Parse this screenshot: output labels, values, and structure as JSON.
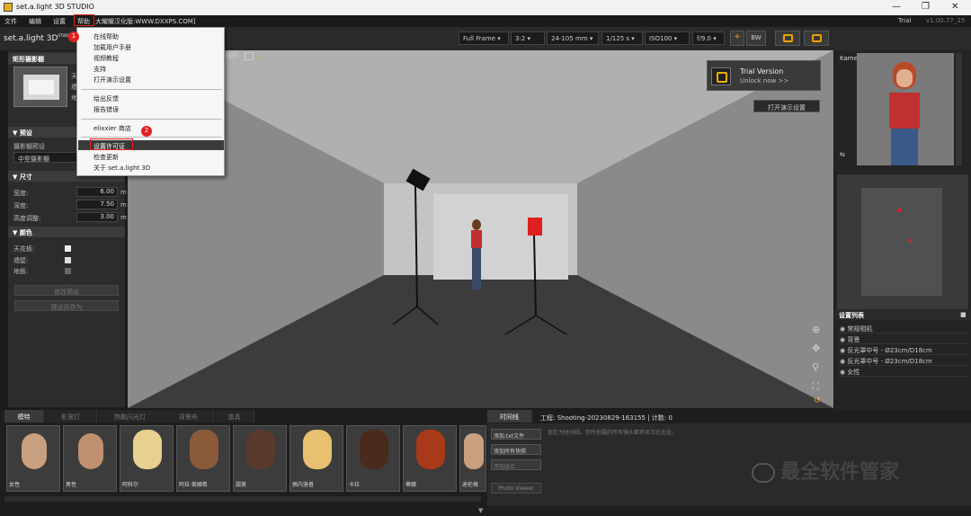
{
  "window": {
    "title": "set.a.light 3D STUDIO",
    "minimize": "—",
    "maximize": "❐",
    "close": "✕"
  },
  "menubar": {
    "items": [
      "文件",
      "编辑",
      "设置",
      "帮助"
    ],
    "tagline": "大耀耀汉化版:WWW.DXXPS.COM]",
    "trial": "Trial",
    "version": "v1.00.77_25"
  },
  "toolbar": {
    "logo": "set.a.light 3D",
    "logo_sup": "STUDIO",
    "frame": "Full Frame",
    "ratio": "3:2",
    "lens": "24-105 mm",
    "shutter": "1/125 s",
    "iso": "ISO100",
    "aperture": "f/9.0",
    "bw": "BW"
  },
  "help_menu": {
    "items": [
      "在线帮助",
      "加载用户手册",
      "视频教程",
      "支持",
      "打开演示设置",
      "给出反馈",
      "报告错误",
      "elixxier 商店",
      "设置许可证",
      "检查更新",
      "关于 set.a.light 3D"
    ],
    "highlighted": "设置许可证"
  },
  "annotations": {
    "badge1": "1",
    "badge2": "2"
  },
  "left_panel": {
    "studio_title": "矩形摄影棚",
    "studio_desc": [
      "天花",
      "墙壁",
      "地板"
    ],
    "preset_header": "预设",
    "preset_label": "摄影棚预设",
    "preset_value": "中型摄影棚",
    "size_header": "尺寸",
    "width_label": "宽度:",
    "width_value": "6.00",
    "depth_label": "深度:",
    "depth_value": "7.50",
    "height_label": "高度调整:",
    "height_value": "3.00",
    "unit": "m",
    "color_header": "颜色",
    "ceiling_label": "天花板:",
    "wall_label": "墙壁:",
    "floor_label": "地板:",
    "modify_btn": "修改预设",
    "save_btn": "预设另存为"
  },
  "viewport": {
    "view_label": "视图:"
  },
  "trial_panel": {
    "title": "Trial Version",
    "subtitle": "Unlock now >>"
  },
  "demo_button": "打开演示设置",
  "right_panel": {
    "camera_label": "Kamera",
    "list_header": "设置列表",
    "items": [
      "常规相机",
      "背景",
      "反光罩中号 - Ø23cm/D18cm",
      "反光罩中号 - Ø23cm/D18cm",
      "女性"
    ]
  },
  "bottom": {
    "tabs": [
      "模特",
      "影室灯",
      "热靴闪光灯",
      "背景布",
      "道具"
    ],
    "models": [
      "女性",
      "男性",
      "阿科尔",
      "阿拉·美娜希",
      "甜美",
      "佩内洛普",
      "卡拉",
      "蒂娜",
      "",
      "迪伦格"
    ],
    "timeline_tab": "时间线",
    "project": "工程: Shooting-20230829-163155 | 计数: 0",
    "timeline_hint": "现在为时间线。你所拍摄的所有镜头都将显示在此处。",
    "actions": [
      "添加.txt文件",
      "添加所有快照",
      "添加组合"
    ],
    "photo_viewer": "Photo Viewer"
  },
  "watermark": "最全软件管家"
}
